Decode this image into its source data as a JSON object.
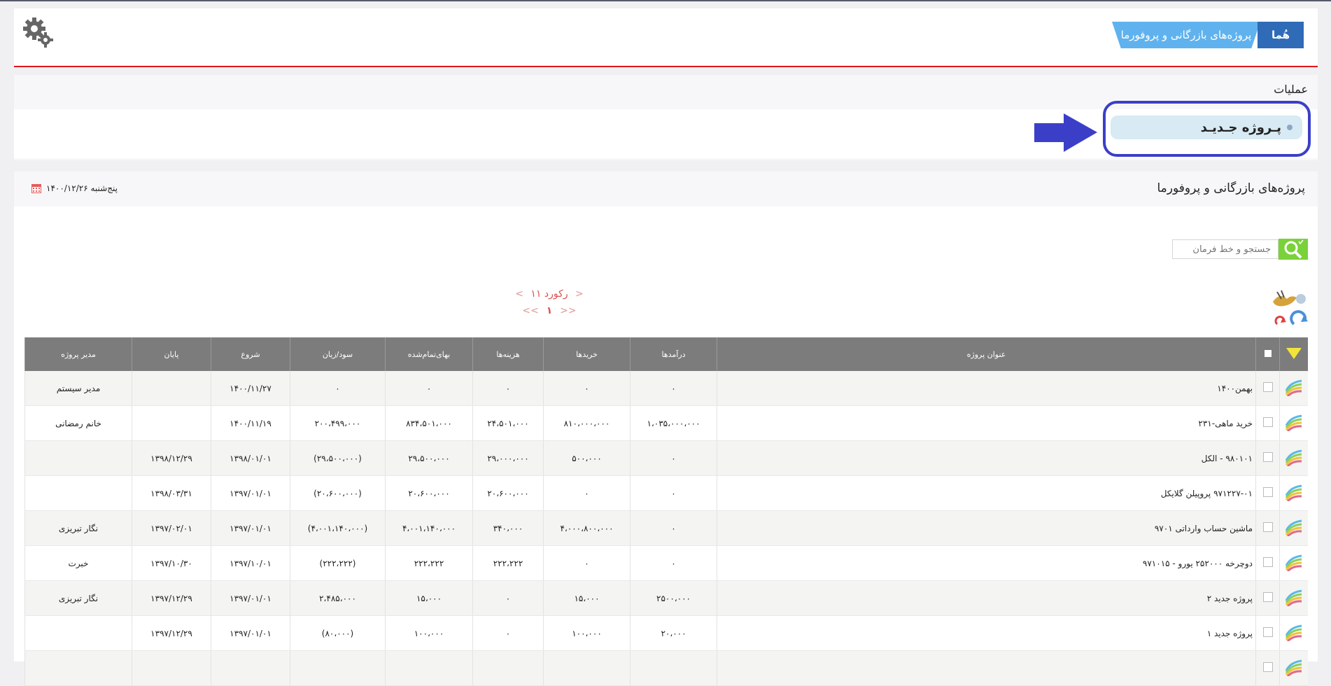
{
  "header": {
    "home_label": "هُما",
    "breadcrumb_project": "پروژه‌های بازرگانی و پروفورما"
  },
  "operations": {
    "title": "عملیات",
    "new_project_label": "پـروژه جـدیـد"
  },
  "main": {
    "title": "پروژه‌های بازرگانی و پروفورما",
    "date": "پنج‌شنبه ۱۴۰۰/۱۲/۲۶"
  },
  "search": {
    "placeholder": "جستجو و خط فرمان"
  },
  "pager": {
    "records": "۱۱ رکورد",
    "prev": "<",
    "next": ">",
    "first": "<<",
    "last": ">>",
    "current_page": "۱"
  },
  "table": {
    "headers": {
      "title": "عنوان پروژه",
      "income": "درآمدها",
      "purchases": "خریدها",
      "costs": "هزینه‌ها",
      "cost_price": "بهای‌تمام‌شده",
      "profit": "سود/زیان",
      "start": "شروع",
      "end": "پایان",
      "manager": "مدیر پروژه"
    },
    "rows": [
      {
        "title": "بهمن۱۴۰۰",
        "income": "۰",
        "purchases": "۰",
        "costs": "۰",
        "cost_price": "۰",
        "profit": "۰",
        "start": "۱۴۰۰/۱۱/۲۷",
        "end": "",
        "manager": "مدیر سیستم"
      },
      {
        "title": "خرید ماهی-۲۳۱",
        "income": "۱،۰۳۵،۰۰۰،۰۰۰",
        "purchases": "۸۱۰،۰۰۰،۰۰۰",
        "costs": "۲۴،۵۰۱،۰۰۰",
        "cost_price": "۸۳۴،۵۰۱،۰۰۰",
        "profit": "۲۰۰،۴۹۹،۰۰۰",
        "start": "۱۴۰۰/۱۱/۱۹",
        "end": "",
        "manager": "خانم رمضانی"
      },
      {
        "title": "۹۸۰۱۰۱ - الکل",
        "income": "۰",
        "purchases": "۵۰۰،۰۰۰",
        "costs": "۲۹،۰۰۰،۰۰۰",
        "cost_price": "۲۹،۵۰۰،۰۰۰",
        "profit": "(۲۹،۵۰۰،۰۰۰)",
        "start": "۱۳۹۸/۰۱/۰۱",
        "end": "۱۳۹۸/۱۲/۲۹",
        "manager": ""
      },
      {
        "title": "۹۷۱۲۲۷-۰۱ پروپیلن گلایکل",
        "income": "۰",
        "purchases": "۰",
        "costs": "۲۰،۶۰۰،۰۰۰",
        "cost_price": "۲۰،۶۰۰،۰۰۰",
        "profit": "(۲۰،۶۰۰،۰۰۰)",
        "start": "۱۳۹۷/۰۱/۰۱",
        "end": "۱۳۹۸/۰۳/۳۱",
        "manager": ""
      },
      {
        "title": "ماشین حساب وارداتی ۹۷۰۱",
        "income": "۰",
        "purchases": "۴،۰۰۰،۸۰۰،۰۰۰",
        "costs": "۳۴۰،۰۰۰",
        "cost_price": "۴،۰۰۱،۱۴۰،۰۰۰",
        "profit": "(۴،۰۰۱،۱۴۰،۰۰۰)",
        "start": "۱۳۹۷/۰۱/۰۱",
        "end": "۱۳۹۷/۰۲/۰۱",
        "manager": "نگار تبریزی"
      },
      {
        "title": "دوچرخه ۲۵۲۰۰۰ یورو - ۹۷۱۰۱۵",
        "income": "۰",
        "purchases": "۰",
        "costs": "۲۲۲،۲۲۲",
        "cost_price": "۲۲۲،۲۲۲",
        "profit": "(۲۲۲،۲۲۲)",
        "start": "۱۳۹۷/۱۰/۰۱",
        "end": "۱۳۹۷/۱۰/۳۰",
        "manager": "خبرت"
      },
      {
        "title": "پروژه جدید ۲",
        "income": "۲۵۰۰،۰۰۰",
        "purchases": "۱۵،۰۰۰",
        "costs": "۰",
        "cost_price": "۱۵،۰۰۰",
        "profit": "۲،۴۸۵،۰۰۰",
        "start": "۱۳۹۷/۰۱/۰۱",
        "end": "۱۳۹۷/۱۲/۲۹",
        "manager": "نگار تبریزی"
      },
      {
        "title": "پروژه جدید ۱",
        "income": "۲۰،۰۰۰",
        "purchases": "۱۰۰،۰۰۰",
        "costs": "۰",
        "cost_price": "۱۰۰،۰۰۰",
        "profit": "(۸۰،۰۰۰)",
        "start": "۱۳۹۷/۰۱/۰۱",
        "end": "۱۳۹۷/۱۲/۲۹",
        "manager": ""
      },
      {
        "title": "",
        "income": "",
        "purchases": "",
        "costs": "",
        "cost_price": "",
        "profit": "",
        "start": "",
        "end": "",
        "manager": ""
      }
    ]
  },
  "colors": {
    "accent_red": "#e0161a",
    "highlight_blue": "#3b3fc8",
    "table_header": "#7c7c7c",
    "search_green": "#7ad23a"
  },
  "icons": [
    "gear-icon",
    "arrow-right-icon",
    "calendar-icon",
    "search-icon",
    "sort-triangle-icon",
    "refresh-icon",
    "row-chart-icon"
  ]
}
